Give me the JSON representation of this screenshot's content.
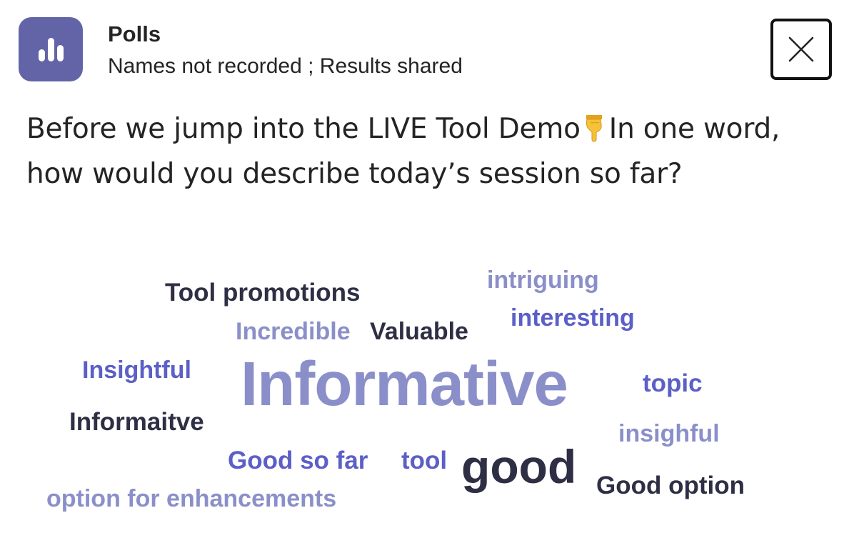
{
  "header": {
    "app_name": "Polls",
    "subtitle": "Names not recorded ; Results shared",
    "app_icon": "bar-chart-icon",
    "close_icon": "close-icon"
  },
  "question": {
    "text_before": "Before we jump into the LIVE Tool Demo",
    "emoji": "backhand-index-pointing-down",
    "text_after": "In one word, how would you describe today’s session so far?"
  },
  "colors": {
    "brand": "#6264a7",
    "dark": "#2e2f45",
    "medium": "#5b5fc7",
    "light": "#8b8fc9"
  },
  "word_cloud": {
    "words": [
      {
        "text": "Tool promotions"
      },
      {
        "text": "intriguing"
      },
      {
        "text": "Incredible"
      },
      {
        "text": "Valuable"
      },
      {
        "text": "interesting"
      },
      {
        "text": "Insightful"
      },
      {
        "text": "Informative"
      },
      {
        "text": "topic"
      },
      {
        "text": "Informaitve"
      },
      {
        "text": "insighful"
      },
      {
        "text": "Good so far"
      },
      {
        "text": "tool"
      },
      {
        "text": "good"
      },
      {
        "text": "Good option"
      },
      {
        "text": "option for enhancements"
      }
    ]
  }
}
